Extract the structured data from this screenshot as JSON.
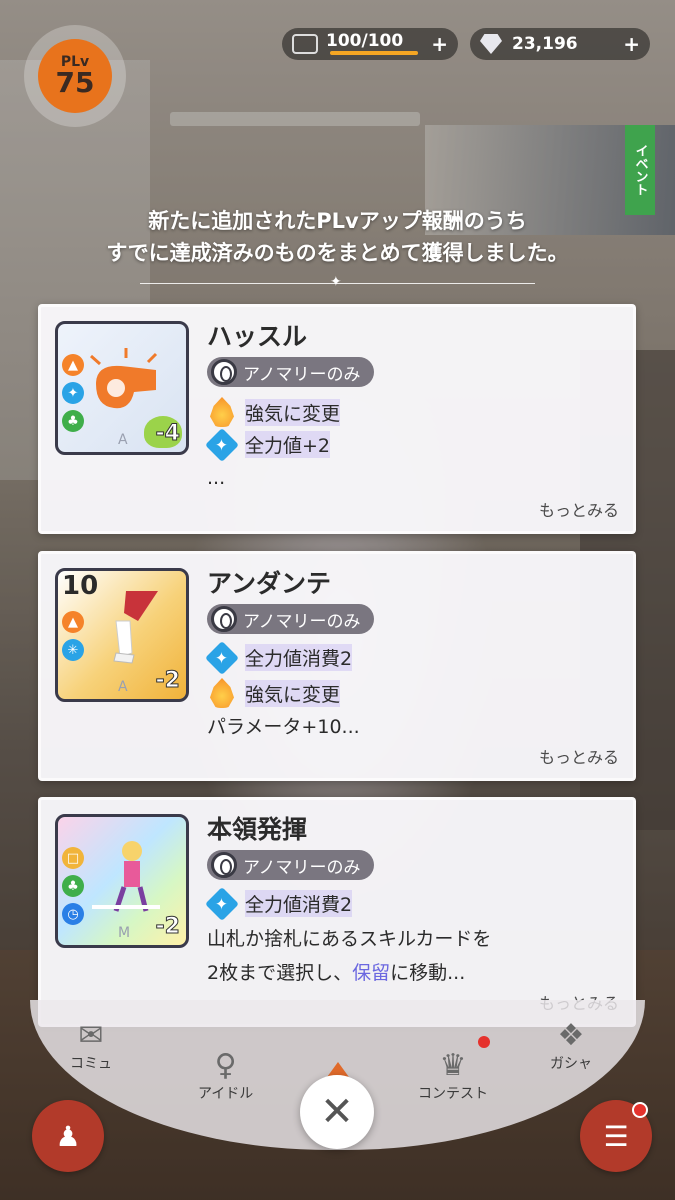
{
  "hud": {
    "plv_label": "PLv",
    "plv_value": "75",
    "stamina_text": "100/100",
    "stamina_fill": 1.0,
    "gems_text": "23,196",
    "plus": "+"
  },
  "event_tab": "イベント",
  "notice": {
    "line1": "新たに追加されたPLvアップ報酬のうち",
    "line2": "すでに達成済みのものをまとめて獲得しました。"
  },
  "cards": [
    {
      "title": "ハッスル",
      "tag": "アノマリーのみ",
      "cost": "",
      "badge": "-4",
      "letter": "A",
      "effects": [
        {
          "icon": "fire",
          "text": "強気に変更"
        },
        {
          "icon": "star",
          "text": "全力値+2"
        }
      ],
      "extra": "...",
      "more": "もっとみる"
    },
    {
      "title": "アンダンテ",
      "tag": "アノマリーのみ",
      "cost": "10",
      "badge": "-2",
      "letter": "A",
      "effects": [
        {
          "icon": "star",
          "text": "全力値消費2"
        },
        {
          "icon": "fire",
          "text": "強気に変更"
        }
      ],
      "extra": "パラメータ+10...",
      "more": "もっとみる"
    },
    {
      "title": "本領発揮",
      "tag": "アノマリーのみ",
      "cost": "",
      "badge": "-2",
      "letter": "M",
      "effects": [
        {
          "icon": "star",
          "text": "全力値消費2"
        }
      ],
      "extra_line1": "山札か捨札にあるスキルカードを",
      "extra_line2_a": "2枚まで選択し、",
      "extra_line2_link": "保留",
      "extra_line2_b": "に移動...",
      "more": "もっとみる"
    }
  ],
  "nav": {
    "items": [
      "コミュ",
      "アイドル",
      "コンテスト",
      "ガシャ"
    ]
  },
  "close_symbol": "✕"
}
